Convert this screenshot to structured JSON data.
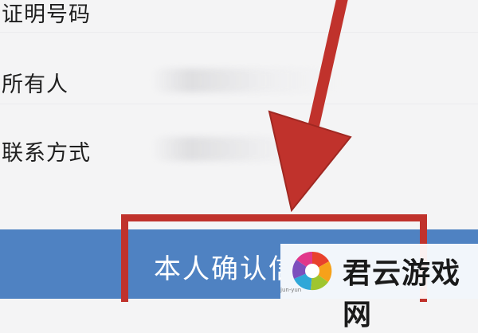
{
  "form": {
    "fields": [
      {
        "label": "证明号码"
      },
      {
        "label": "所有人"
      },
      {
        "label": "联系方式"
      }
    ]
  },
  "confirm_button": {
    "label": "本人确认信"
  },
  "colors": {
    "button": "#4f82c2",
    "annotation": "#c0322c"
  },
  "watermark": {
    "name": "君云游戏网",
    "sub": "jun-yun"
  }
}
